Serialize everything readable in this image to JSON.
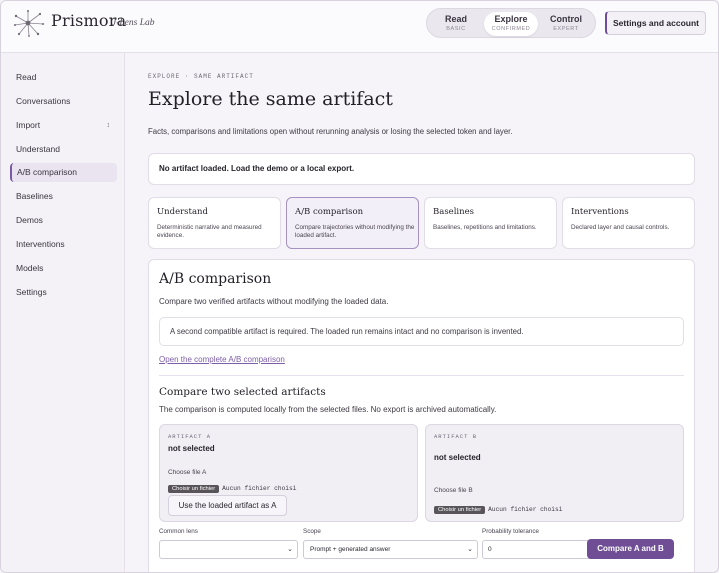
{
  "header": {
    "brand": "Prismora",
    "brand_sub": "J-Lens Lab",
    "modes": [
      {
        "label": "Read",
        "sub": "BASIC"
      },
      {
        "label": "Explore",
        "sub": "CONFIRMED"
      },
      {
        "label": "Control",
        "sub": "EXPERT"
      }
    ],
    "settings_label": "Settings and account",
    "accent": "#6f4e96"
  },
  "sidebar": {
    "items": [
      {
        "label": "Read"
      },
      {
        "label": "Conversations"
      },
      {
        "label": "Import",
        "caret": "↕"
      },
      {
        "label": "Understand"
      },
      {
        "label": "A/B comparison"
      },
      {
        "label": "Baselines"
      },
      {
        "label": "Demos"
      },
      {
        "label": "Interventions"
      },
      {
        "label": "Models"
      },
      {
        "label": "Settings"
      }
    ]
  },
  "main": {
    "eyebrow": "EXPLORE · SAME ARTIFACT",
    "title": "Explore the same artifact",
    "description": "Facts, comparisons and limitations open without rerunning analysis or losing the selected token and layer.",
    "notice": "No artifact loaded. Load the demo or a local export.",
    "cards": [
      {
        "title": "Understand",
        "desc": "Deterministic narrative and measured evidence."
      },
      {
        "title": "A/B comparison",
        "desc": "Compare trajectories without modifying the loaded artifact."
      },
      {
        "title": "Baselines",
        "desc": "Baselines, repetitions and limitations."
      },
      {
        "title": "Interventions",
        "desc": "Declared layer and causal controls."
      }
    ]
  },
  "panel": {
    "title": "A/B comparison",
    "description": "Compare two verified artifacts without modifying the loaded data.",
    "notice": "A second compatible artifact is required. The loaded run remains intact and no comparison is invented.",
    "link": "Open the complete A/B comparison",
    "sub_title": "Compare two selected artifacts",
    "sub_desc": "The comparison is computed locally from the selected files. No export is archived automatically.",
    "artifact_a": {
      "label": "ARTIFACT A",
      "value": "not selected",
      "file_label": "Choose file A",
      "file_button": "Choisir un fichier",
      "file_none": "Aucun fichier choisi",
      "use_button": "Use the loaded artifact as A"
    },
    "artifact_b": {
      "label": "ARTIFACT B",
      "value": "not selected",
      "file_label": "Choose file B",
      "file_button": "Choisir un fichier",
      "file_none": "Aucun fichier choisi"
    },
    "common_lens": {
      "label": "Common lens",
      "value": ""
    },
    "scope": {
      "label": "Scope",
      "value": "Prompt + generated answer"
    },
    "tolerance": {
      "label": "Probability tolerance",
      "value": "0"
    },
    "compare_button": "Compare A and B"
  }
}
